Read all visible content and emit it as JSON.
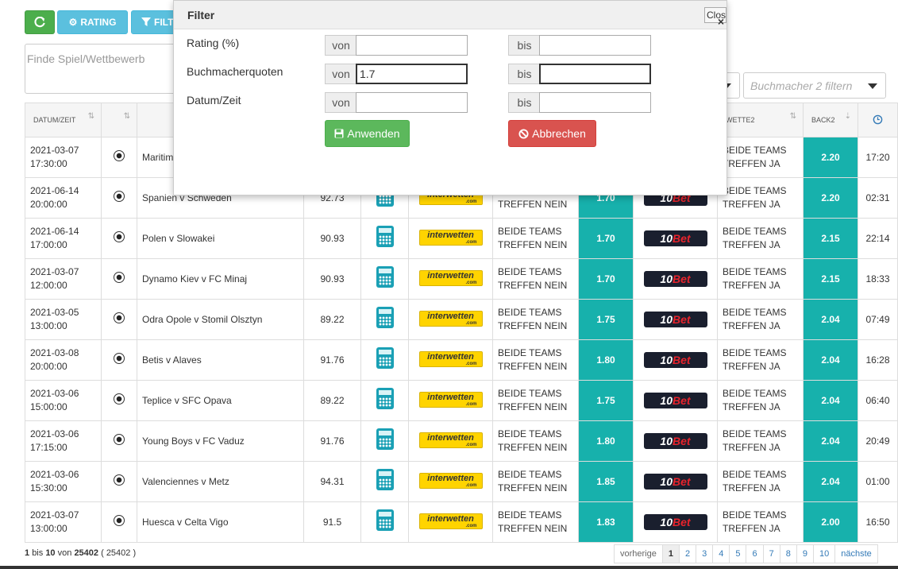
{
  "toolbar": {
    "rating_label": "RATING",
    "filter_label": "FILT"
  },
  "search": {
    "placeholder": "Finde Spiel/Wettbewerb"
  },
  "bookmaker2_filter": {
    "placeholder": "Buchmacher 2 filtern"
  },
  "table": {
    "headers": [
      "DATUM/ZEIT",
      "",
      "",
      "",
      "",
      "",
      "",
      "",
      "",
      "WETTE2",
      "BACK2",
      ""
    ],
    "rows": [
      {
        "date": "2021-03-07",
        "time": "17:30:00",
        "match": "Maritim",
        "rating": "",
        "bet1": "",
        "back1": "",
        "bet2_l1": "BEIDE TEAMS",
        "bet2_l2": "TREFFEN JA",
        "back2": "2.20",
        "clock": "17:20"
      },
      {
        "date": "2021-06-14",
        "time": "20:00:00",
        "match": "Spanien v Schweden",
        "rating": "92.73",
        "bet1_l1": "",
        "bet1_l2": "TREFFEN NEIN",
        "back1": "1.70",
        "bet2_l1": "BEIDE TEAMS",
        "bet2_l2": "TREFFEN JA",
        "back2": "2.20",
        "clock": "02:31"
      },
      {
        "date": "2021-06-14",
        "time": "17:00:00",
        "match": "Polen v Slowakei",
        "rating": "90.93",
        "bet1_l1": "BEIDE TEAMS",
        "bet1_l2": "TREFFEN NEIN",
        "back1": "1.70",
        "bet2_l1": "BEIDE TEAMS",
        "bet2_l2": "TREFFEN JA",
        "back2": "2.15",
        "clock": "22:14"
      },
      {
        "date": "2021-03-07",
        "time": "12:00:00",
        "match": "Dynamo Kiev v FC Minaj",
        "rating": "90.93",
        "bet1_l1": "BEIDE TEAMS",
        "bet1_l2": "TREFFEN NEIN",
        "back1": "1.70",
        "bet2_l1": "BEIDE TEAMS",
        "bet2_l2": "TREFFEN JA",
        "back2": "2.15",
        "clock": "18:33"
      },
      {
        "date": "2021-03-05",
        "time": "13:00:00",
        "match": "Odra Opole v Stomil Olsztyn",
        "rating": "89.22",
        "bet1_l1": "BEIDE TEAMS",
        "bet1_l2": "TREFFEN NEIN",
        "back1": "1.75",
        "bet2_l1": "BEIDE TEAMS",
        "bet2_l2": "TREFFEN JA",
        "back2": "2.04",
        "clock": "07:49"
      },
      {
        "date": "2021-03-08",
        "time": "20:00:00",
        "match": "Betis v Alaves",
        "rating": "91.76",
        "bet1_l1": "BEIDE TEAMS",
        "bet1_l2": "TREFFEN NEIN",
        "back1": "1.80",
        "bet2_l1": "BEIDE TEAMS",
        "bet2_l2": "TREFFEN JA",
        "back2": "2.04",
        "clock": "16:28"
      },
      {
        "date": "2021-03-06",
        "time": "15:00:00",
        "match": "Teplice v SFC Opava",
        "rating": "89.22",
        "bet1_l1": "BEIDE TEAMS",
        "bet1_l2": "TREFFEN NEIN",
        "back1": "1.75",
        "bet2_l1": "BEIDE TEAMS",
        "bet2_l2": "TREFFEN JA",
        "back2": "2.04",
        "clock": "06:40"
      },
      {
        "date": "2021-03-06",
        "time": "17:15:00",
        "match": "Young Boys v FC Vaduz",
        "rating": "91.76",
        "bet1_l1": "BEIDE TEAMS",
        "bet1_l2": "TREFFEN NEIN",
        "back1": "1.80",
        "bet2_l1": "BEIDE TEAMS",
        "bet2_l2": "TREFFEN JA",
        "back2": "2.04",
        "clock": "20:49"
      },
      {
        "date": "2021-03-06",
        "time": "15:30:00",
        "match": "Valenciennes v Metz",
        "rating": "94.31",
        "bet1_l1": "BEIDE TEAMS",
        "bet1_l2": "TREFFEN NEIN",
        "back1": "1.85",
        "bet2_l1": "BEIDE TEAMS",
        "bet2_l2": "TREFFEN JA",
        "back2": "2.04",
        "clock": "01:00"
      },
      {
        "date": "2021-03-07",
        "time": "13:00:00",
        "match": "Huesca v Celta Vigo",
        "rating": "91.5",
        "bet1_l1": "BEIDE TEAMS",
        "bet1_l2": "TREFFEN NEIN",
        "back1": "1.83",
        "bet2_l1": "BEIDE TEAMS",
        "bet2_l2": "TREFFEN JA",
        "back2": "2.00",
        "clock": "16:50"
      }
    ]
  },
  "footer": {
    "from": "1",
    "bis": "bis",
    "to": "10",
    "von": "von",
    "total": "25402",
    "total_paren": "( 25402 )"
  },
  "pagination": {
    "prev": "vorherige",
    "pages": [
      "1",
      "2",
      "3",
      "4",
      "5",
      "6",
      "7",
      "8",
      "9",
      "10"
    ],
    "next": "nächste"
  },
  "modal": {
    "title": "Filter",
    "close_label": "Close",
    "close_x": "×",
    "fields": [
      {
        "label": "Rating (%)",
        "von_label": "von",
        "von_value": "",
        "bis_label": "bis",
        "bis_value": ""
      },
      {
        "label": "Buchmacherquoten",
        "von_label": "von",
        "von_value": "1.7",
        "bis_label": "bis",
        "bis_value": ""
      },
      {
        "label": "Datum/Zeit",
        "von_label": "von",
        "von_value": "",
        "bis_label": "bis",
        "bis_value": ""
      }
    ],
    "apply_label": "Anwenden",
    "cancel_label": "Abbrechen"
  },
  "logos": {
    "interwetten": "interwetten",
    "interwetten_com": ".com",
    "tenbet_a": "10",
    "tenbet_b": "Bet"
  },
  "colors": {
    "teal": "#17b1ac",
    "green": "#5cb85c",
    "red": "#d9534f",
    "info": "#5bc0de"
  }
}
